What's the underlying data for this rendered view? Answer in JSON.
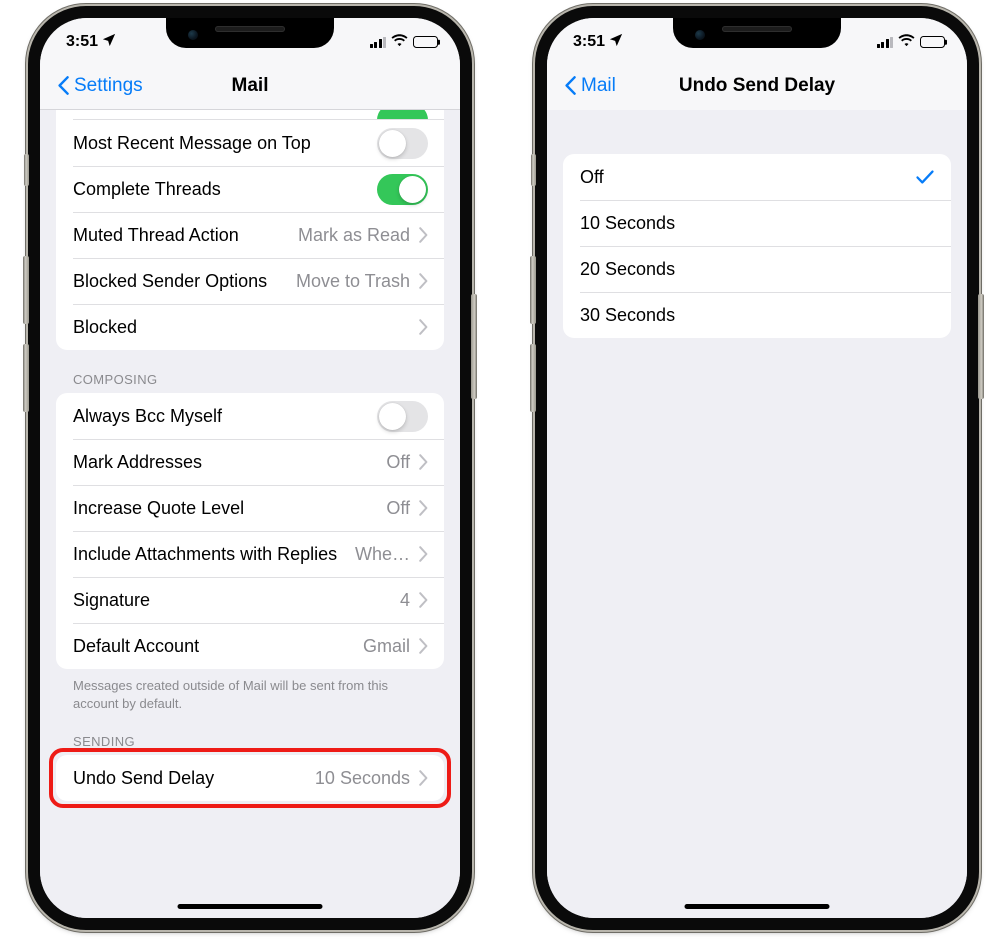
{
  "status_bar": {
    "time": "3:51",
    "location_icon": "location-arrow-icon",
    "cellular_icon": "cellular-signal-icon",
    "wifi_icon": "wifi-icon",
    "battery_icon": "battery-icon",
    "battery_level_pct": 70,
    "signal_bars_filled": 3,
    "signal_bars_total": 4
  },
  "colors": {
    "accent_blue": "#067cf8",
    "toggle_green": "#34c759",
    "highlight_red": "#ee1b16",
    "value_gray": "#8e8e93",
    "background_gray": "#efeff4"
  },
  "left_phone": {
    "nav": {
      "back_label": "Settings",
      "back_icon": "chevron-left-icon",
      "title": "Mail"
    },
    "threading_rows": [
      {
        "label": "Most Recent Message on Top",
        "type": "toggle",
        "value": "off"
      },
      {
        "label": "Complete Threads",
        "type": "toggle",
        "value": "on"
      },
      {
        "label": "Muted Thread Action",
        "type": "disclosure",
        "value": "Mark as Read"
      },
      {
        "label": "Blocked Sender Options",
        "type": "disclosure",
        "value": "Move to Trash"
      },
      {
        "label": "Blocked",
        "type": "disclosure",
        "value": ""
      }
    ],
    "composing": {
      "header": "COMPOSING",
      "rows": [
        {
          "label": "Always Bcc Myself",
          "type": "toggle",
          "value": "off"
        },
        {
          "label": "Mark Addresses",
          "type": "disclosure",
          "value": "Off"
        },
        {
          "label": "Increase Quote Level",
          "type": "disclosure",
          "value": "Off"
        },
        {
          "label": "Include Attachments with Replies",
          "type": "disclosure",
          "value": "Whe…"
        },
        {
          "label": "Signature",
          "type": "disclosure",
          "value": "4"
        },
        {
          "label": "Default Account",
          "type": "disclosure",
          "value": "Gmail"
        }
      ],
      "footer": "Messages created outside of Mail will be sent from this account by default."
    },
    "sending": {
      "header": "SENDING",
      "row": {
        "label": "Undo Send Delay",
        "type": "disclosure",
        "value": "10 Seconds",
        "highlighted": true
      }
    }
  },
  "right_phone": {
    "nav": {
      "back_label": "Mail",
      "back_icon": "chevron-left-icon",
      "title": "Undo Send Delay"
    },
    "options": [
      {
        "label": "Off",
        "selected": true
      },
      {
        "label": "10 Seconds",
        "selected": false
      },
      {
        "label": "20 Seconds",
        "selected": false
      },
      {
        "label": "30 Seconds",
        "selected": false
      }
    ]
  }
}
